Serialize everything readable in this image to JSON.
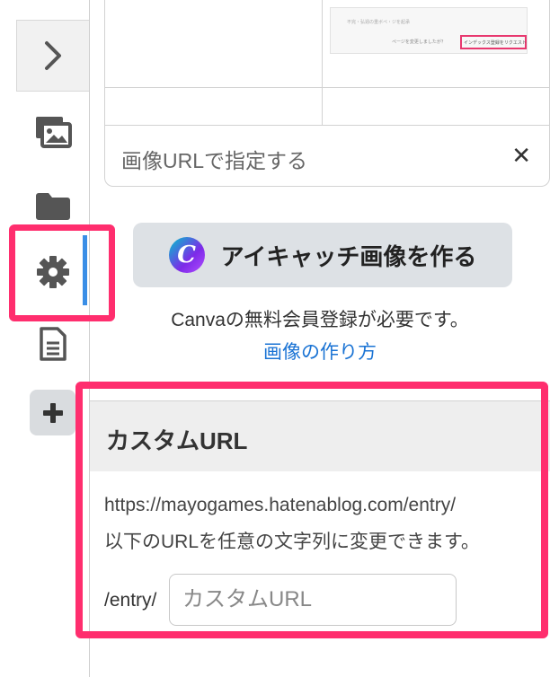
{
  "colors": {
    "highlight": "#ff2e6e",
    "accent_bar": "#3a8ee6",
    "link": "#1a73d4"
  },
  "sidebar": {
    "items": [
      {
        "name": "expand",
        "icon": "chevron-right-icon"
      },
      {
        "name": "images",
        "icon": "images-icon"
      },
      {
        "name": "folder",
        "icon": "folder-icon"
      },
      {
        "name": "settings",
        "icon": "gear-icon",
        "active": true
      },
      {
        "name": "document",
        "icon": "document-icon"
      },
      {
        "name": "add",
        "icon": "plus-icon"
      }
    ]
  },
  "image_panel": {
    "thumbnail_texts": [
      "不完・弘週の重ボペ・ジを起承",
      "ページを変更しましたが？",
      "インデックス登録をリクエスト"
    ],
    "url_label": "画像URLで指定する",
    "close_symbol": "✕"
  },
  "canva": {
    "logo_letter": "C",
    "button_label": "アイキャッチ画像を作る",
    "note": "Canvaの無料会員登録が必要です。",
    "howto_link": "画像の作り方"
  },
  "custom_url": {
    "title": "カスタムURL",
    "desc_line1": "https://mayogames.hatenablog.com/entry/",
    "desc_line2": "以下のURLを任意の文字列に変更できます。",
    "prefix": "/entry/",
    "input_value": "",
    "input_placeholder": "カスタムURL"
  }
}
